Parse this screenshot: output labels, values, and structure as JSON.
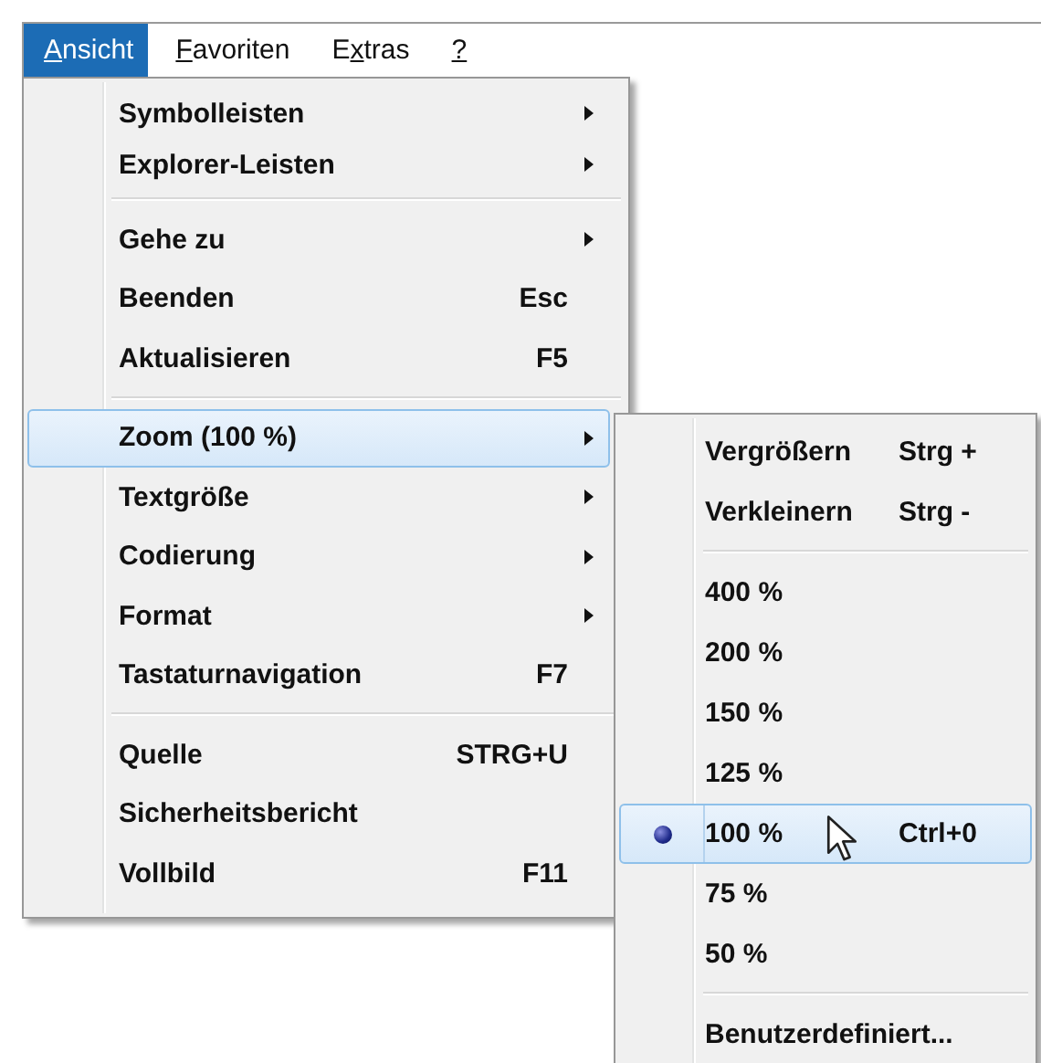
{
  "menubar": [
    {
      "key": "A",
      "after": "nsicht",
      "selected": true
    },
    {
      "key": "F",
      "after": "avoriten",
      "selected": false
    },
    {
      "before": "E",
      "key": "x",
      "after": "tras",
      "selected": false
    },
    {
      "key": "?",
      "selected": false
    }
  ],
  "menu": [
    {
      "kind": "item",
      "label": "Symbolleisten",
      "submenu": true,
      "selected": false
    },
    {
      "kind": "item",
      "label": "Explorer-Leisten",
      "submenu": true,
      "selected": false
    },
    {
      "kind": "separator"
    },
    {
      "kind": "item",
      "label": "Gehe zu",
      "submenu": true,
      "selected": false
    },
    {
      "kind": "item",
      "label": "Beenden",
      "shortcut": "Esc",
      "submenu": false,
      "selected": false
    },
    {
      "kind": "item",
      "label": "Aktualisieren",
      "shortcut": "F5",
      "submenu": false,
      "selected": false
    },
    {
      "kind": "separator"
    },
    {
      "kind": "item",
      "label": "Zoom (100 %)",
      "submenu": true,
      "selected": true
    },
    {
      "kind": "item",
      "label": "Textgröße",
      "submenu": true,
      "selected": false
    },
    {
      "kind": "item",
      "label": "Codierung",
      "submenu": true,
      "selected": false
    },
    {
      "kind": "item",
      "label": "Format",
      "submenu": true,
      "selected": false
    },
    {
      "kind": "item",
      "label": "Tastaturnavigation",
      "shortcut": "F7",
      "submenu": false,
      "selected": false
    },
    {
      "kind": "separator"
    },
    {
      "kind": "item",
      "label": "Quelle",
      "shortcut": "STRG+U",
      "submenu": false,
      "selected": false
    },
    {
      "kind": "item",
      "label": "Sicherheitsbericht",
      "submenu": false,
      "selected": false
    },
    {
      "kind": "item",
      "label": "Vollbild",
      "shortcut": "F11",
      "submenu": false,
      "selected": false
    }
  ],
  "zoom_submenu": [
    {
      "kind": "item",
      "label": "Vergrößern",
      "shortcut": "Strg +",
      "checked": false,
      "selected": false
    },
    {
      "kind": "item",
      "label": "Verkleinern",
      "shortcut": "Strg -",
      "checked": false,
      "selected": false
    },
    {
      "kind": "separator"
    },
    {
      "kind": "item",
      "label": "400 %",
      "checked": false,
      "selected": false
    },
    {
      "kind": "item",
      "label": "200 %",
      "checked": false,
      "selected": false
    },
    {
      "kind": "item",
      "label": "150 %",
      "checked": false,
      "selected": false
    },
    {
      "kind": "item",
      "label": "125 %",
      "checked": false,
      "selected": false
    },
    {
      "kind": "item",
      "label": "100 %",
      "shortcut": "Ctrl+0",
      "checked": true,
      "selected": true
    },
    {
      "kind": "item",
      "label": "75 %",
      "checked": false,
      "selected": false
    },
    {
      "kind": "item",
      "label": "50 %",
      "checked": false,
      "selected": false
    },
    {
      "kind": "separator"
    },
    {
      "kind": "item",
      "label": "Benutzerdefiniert...",
      "checked": false,
      "selected": false
    }
  ]
}
